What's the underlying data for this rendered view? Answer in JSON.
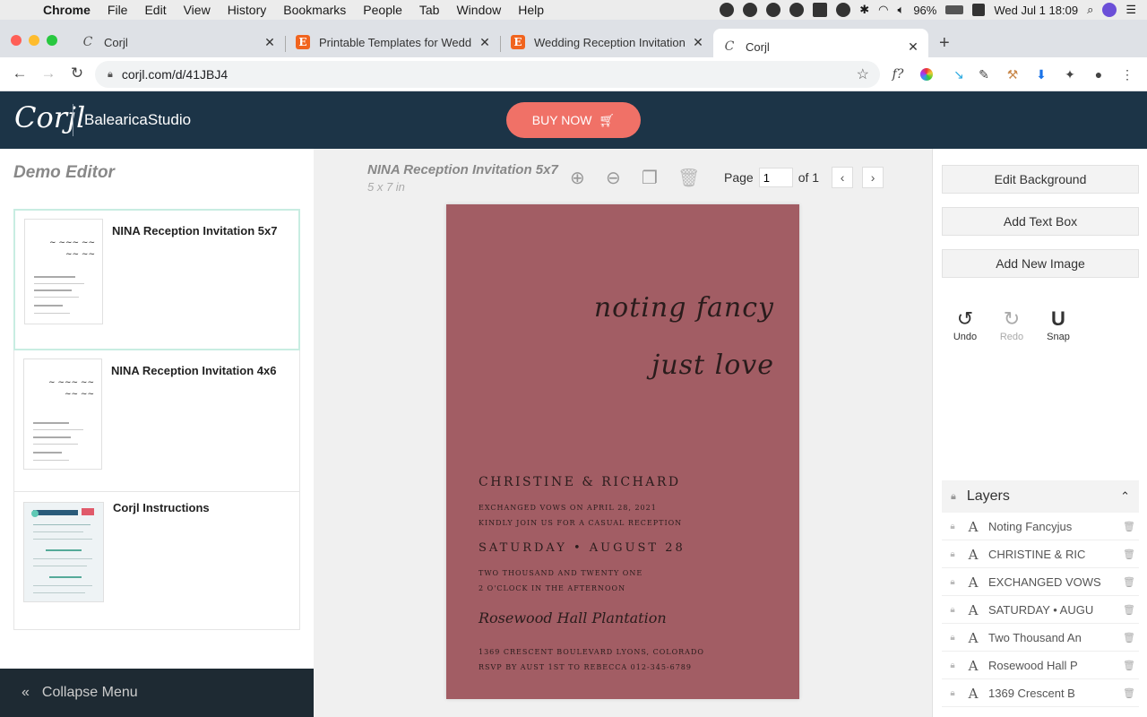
{
  "menubar": {
    "app": "Chrome",
    "items": [
      "File",
      "Edit",
      "View",
      "History",
      "Bookmarks",
      "People",
      "Tab",
      "Window",
      "Help"
    ],
    "battery": "96%",
    "datetime": "Wed Jul 1  18:09"
  },
  "tabs": [
    {
      "title": "Corjl",
      "favicon": "corjl-icon"
    },
    {
      "title": "Printable Templates for Weddin",
      "favicon": "etsy-icon"
    },
    {
      "title": "Wedding Reception Invitation E",
      "favicon": "etsy-icon"
    },
    {
      "title": "Corjl",
      "favicon": "corjl-icon",
      "active": true
    }
  ],
  "address": {
    "url": "corjl.com/d/41JBJ4"
  },
  "header": {
    "logo": "Corjl",
    "studio": "BalearicaStudio",
    "buy_now": "BUY NOW"
  },
  "left": {
    "title": "Demo Editor",
    "templates": [
      {
        "name": "NINA Reception Invitation 5x7",
        "selected": true
      },
      {
        "name": "NINA Reception Invitation 4x6",
        "selected": false
      },
      {
        "name": "Corjl Instructions",
        "selected": false
      }
    ],
    "collapse": "Collapse Menu"
  },
  "center": {
    "doc_title": "NINA Reception Invitation 5x7",
    "doc_size": "5 x 7 in",
    "page_label": "Page",
    "page_value": "1",
    "page_of": "of 1"
  },
  "card": {
    "script_line1": "noting fancy",
    "script_line2": "just love",
    "names": "CHRISTINE & RICHARD",
    "line1": "EXCHANGED VOWS ON APRIL 28, 2021",
    "line2": "KINDLY JOIN US FOR A CASUAL RECEPTION",
    "date": "SATURDAY • AUGUST 28",
    "line3": "TWO THOUSAND AND TWENTY ONE",
    "line4": "2 O'CLOCK IN THE AFTERNOON",
    "venue": "Rosewood Hall Plantation",
    "line5": "1369 CRESCENT BOULEVARD LYONS, COLORADO",
    "line6": "RSVP BY AUST 1ST TO REBECCA  012-345-6789",
    "background_color": "#a25d64"
  },
  "right": {
    "edit_background": "Edit Background",
    "add_text_box": "Add Text Box",
    "add_new_image": "Add New Image",
    "undo": "Undo",
    "redo": "Redo",
    "snap": "Snap",
    "layers_title": "Layers",
    "layers": [
      "Noting Fancyjus",
      "CHRISTINE & RIC",
      "EXCHANGED VOWS",
      "SATURDAY • AUGU",
      "Two Thousand An",
      "Rosewood Hall P",
      "1369 Crescent B"
    ]
  }
}
